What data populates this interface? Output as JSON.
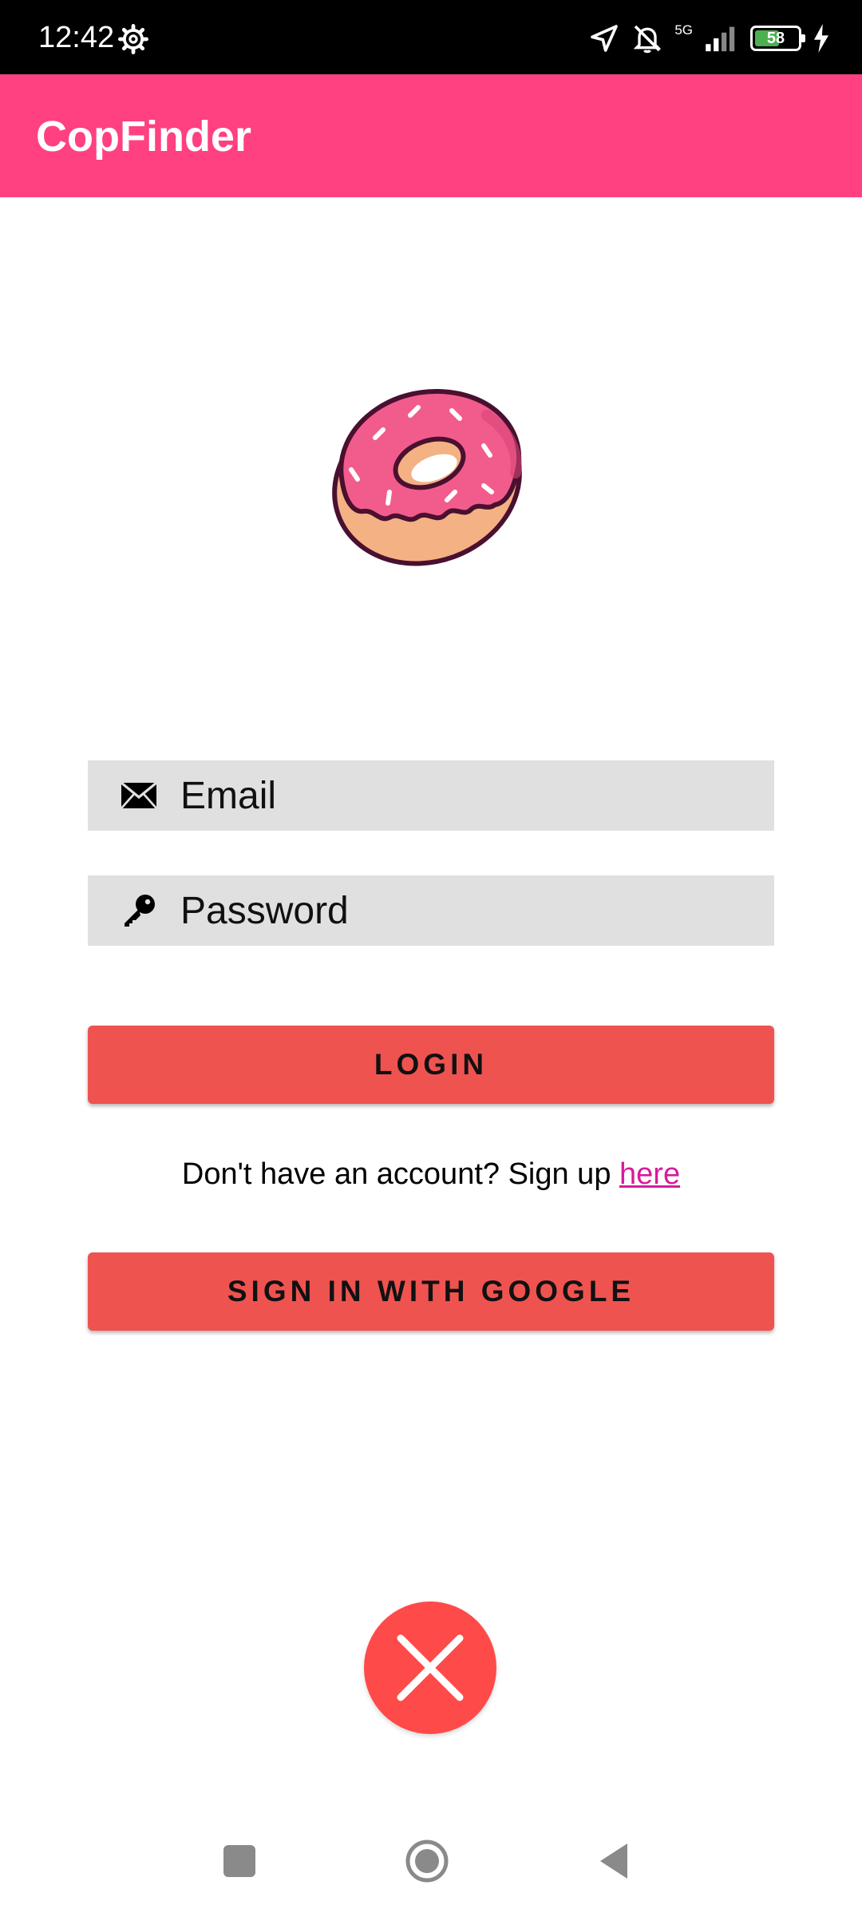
{
  "status_bar": {
    "time": "12:42",
    "network": "5G",
    "battery": 58
  },
  "app_bar": {
    "title": "CopFinder"
  },
  "login_form": {
    "email_placeholder": "Email",
    "password_placeholder": "Password",
    "login_label": "LOGIN",
    "signup_prompt": "Don't have an account? Sign up ",
    "signup_link": "here",
    "google_label": "SIGN IN WITH GOOGLE"
  },
  "icons": {
    "logo": "donut-icon",
    "email": "envelope-icon",
    "password": "key-icon",
    "dismiss": "close-icon"
  },
  "colors": {
    "app_bar": "#ff4081",
    "button": "#ef5350",
    "field": "#e0e0e0",
    "link": "#d81b9a",
    "dismiss": "#ff4a4a"
  }
}
